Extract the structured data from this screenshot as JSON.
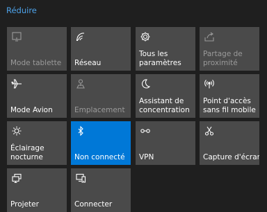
{
  "header": {
    "collapse_label": "Réduire"
  },
  "tiles": [
    {
      "label": "Mode tablette",
      "icon": "tablet-mode-icon",
      "state": "disabled"
    },
    {
      "label": "Réseau",
      "icon": "network-icon",
      "state": "normal"
    },
    {
      "label": "Tous les\nparamètres",
      "icon": "settings-gear-icon",
      "state": "normal"
    },
    {
      "label": "Partage de\nproximité",
      "icon": "nearby-sharing-icon",
      "state": "disabled"
    },
    {
      "label": "Mode Avion",
      "icon": "airplane-icon",
      "state": "normal"
    },
    {
      "label": "Emplacement",
      "icon": "location-icon",
      "state": "disabled"
    },
    {
      "label": "Assistant de\nconcentration",
      "icon": "moon-icon",
      "state": "normal"
    },
    {
      "label": "Point d'accès\nsans fil mobile",
      "icon": "mobile-hotspot-icon",
      "state": "normal"
    },
    {
      "label": "Éclairage\nnocturne",
      "icon": "brightness-icon",
      "state": "normal"
    },
    {
      "label": "Non connecté",
      "icon": "bluetooth-icon",
      "state": "active"
    },
    {
      "label": "VPN",
      "icon": "vpn-icon",
      "state": "normal"
    },
    {
      "label": "Capture d'écran",
      "icon": "screen-snip-icon",
      "state": "normal"
    },
    {
      "label": "Projeter",
      "icon": "project-icon",
      "state": "normal"
    },
    {
      "label": "Connecter",
      "icon": "connect-icon",
      "state": "normal"
    }
  ],
  "colors": {
    "background": "#1f1f1f",
    "tile": "#4a4a4a",
    "tile_active": "#0078d7",
    "text": "#ffffff",
    "text_disabled": "#9a9a9a",
    "link": "#4ea3ea"
  }
}
